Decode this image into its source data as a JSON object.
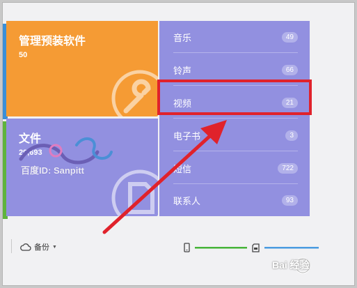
{
  "tiles": {
    "apps": {
      "title": "管理预装软件",
      "count": "50",
      "icon": "wrench-icon",
      "color": "#f59b34"
    },
    "files": {
      "title": "文件",
      "count": "29,693",
      "icon": "file-icon",
      "color": "#9290e0"
    }
  },
  "categories": [
    {
      "label": "音乐",
      "count": "49"
    },
    {
      "label": "铃声",
      "count": "66"
    },
    {
      "label": "视频",
      "count": "21"
    },
    {
      "label": "电子书",
      "count": "3"
    },
    {
      "label": "短信",
      "count": "722"
    },
    {
      "label": "联系人",
      "count": "93"
    }
  ],
  "toolbar": {
    "backup_label": "备份",
    "backup_icon": "cloud-icon"
  },
  "storage": {
    "phone_icon": "phone-icon",
    "sd_icon": "sd-card-icon",
    "phone_color": "#46b438",
    "sd_color": "#4a9be0"
  },
  "watermark": {
    "left_text": "百度ID: Sanpitt",
    "right_text": "Bai 经验"
  },
  "annotation": {
    "highlight_color": "#e0222b"
  }
}
